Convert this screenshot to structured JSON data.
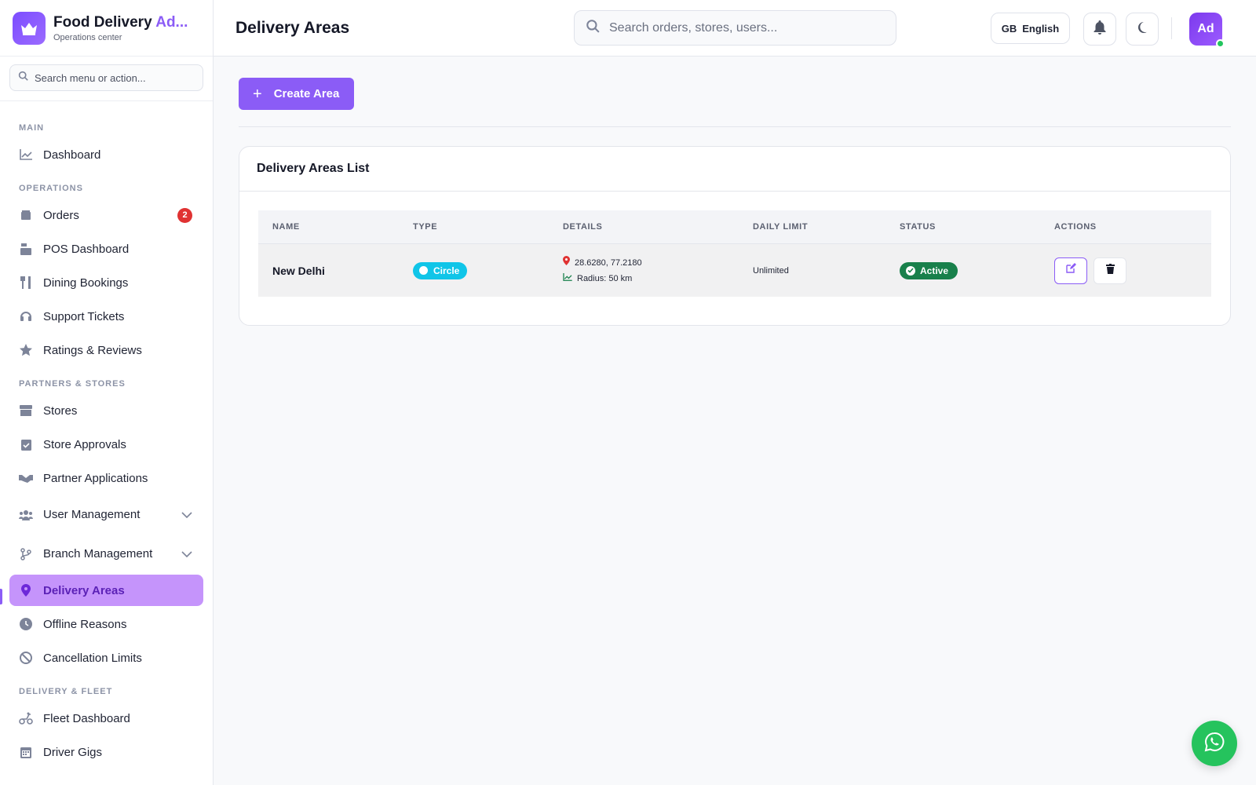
{
  "brand": {
    "title_main": "Food Delivery ",
    "title_accent": "Ad...",
    "subtitle": "Operations center"
  },
  "sidebar": {
    "search_placeholder": "Search menu or action...",
    "sections": {
      "main": "MAIN",
      "operations": "OPERATIONS",
      "partners": "PARTNERS & STORES",
      "fleet": "DELIVERY & FLEET"
    },
    "items": {
      "dashboard": "Dashboard",
      "orders": "Orders",
      "orders_badge": "2",
      "pos": "POS Dashboard",
      "dining": "Dining Bookings",
      "support": "Support Tickets",
      "ratings": "Ratings & Reviews",
      "stores": "Stores",
      "approvals": "Store Approvals",
      "partner_apps": "Partner Applications",
      "user_mgmt": "User Management",
      "branch_mgmt": "Branch Management",
      "delivery_areas": "Delivery Areas",
      "offline": "Offline Reasons",
      "cancellation": "Cancellation Limits",
      "fleet_dash": "Fleet Dashboard",
      "driver_gigs": "Driver Gigs"
    }
  },
  "header": {
    "title": "Delivery Areas",
    "search_placeholder": "Search orders, stores, users...",
    "lang_code": "GB",
    "lang_label": "English",
    "avatar": "Ad"
  },
  "main": {
    "create_label": "Create Area",
    "card_title": "Delivery Areas List",
    "columns": [
      "NAME",
      "TYPE",
      "DETAILS",
      "DAILY LIMIT",
      "STATUS",
      "ACTIONS"
    ],
    "rows": [
      {
        "name": "New Delhi",
        "type": "Circle",
        "coords": "28.6280, 77.2180",
        "radius": "Radius: 50 km",
        "limit": "Unlimited",
        "status": "Active"
      }
    ]
  },
  "colors": {
    "accent": "#8b5cf6",
    "active_bg": "#c594fb",
    "type_badge": "#10c5e8",
    "status_active": "#18804b",
    "whatsapp": "#25c35d"
  },
  "icons": [
    "crown-icon",
    "search-icon",
    "chart-line-icon",
    "box-icon",
    "cash-register-icon",
    "utensils-icon",
    "headset-icon",
    "star-icon",
    "store-icon",
    "clipboard-check-icon",
    "handshake-icon",
    "users-icon",
    "branch-icon",
    "map-pin-icon",
    "clock-icon",
    "ban-icon",
    "moped-icon",
    "calendar-icon",
    "chevron-down-icon",
    "bell-icon",
    "moon-icon",
    "edit-icon",
    "trash-icon",
    "whatsapp-icon"
  ]
}
